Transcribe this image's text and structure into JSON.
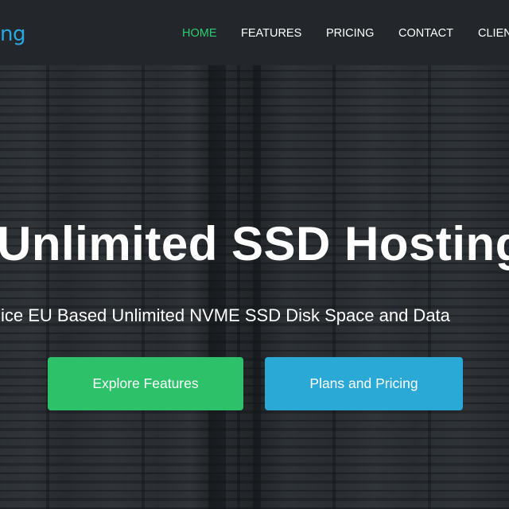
{
  "header": {
    "logo_text": "ng",
    "nav": [
      {
        "label": "HOME",
        "active": true
      },
      {
        "label": "FEATURES",
        "active": false
      },
      {
        "label": "PRICING",
        "active": false
      },
      {
        "label": "CONTACT",
        "active": false
      },
      {
        "label": "CLIEN",
        "active": false
      }
    ]
  },
  "hero": {
    "title": "Unlimited SSD Hosting",
    "subtitle": "ice EU Based Unlimited NVME SSD Disk Space and Data",
    "primary_button": "Explore Features",
    "secondary_button": "Plans and Pricing"
  },
  "colors": {
    "accent_green": "#2dc26a",
    "accent_blue": "#2aa8d6",
    "logo_blue": "#29a8e0",
    "nav_active": "#2ecc71",
    "navbar_bg": "#23272b"
  }
}
